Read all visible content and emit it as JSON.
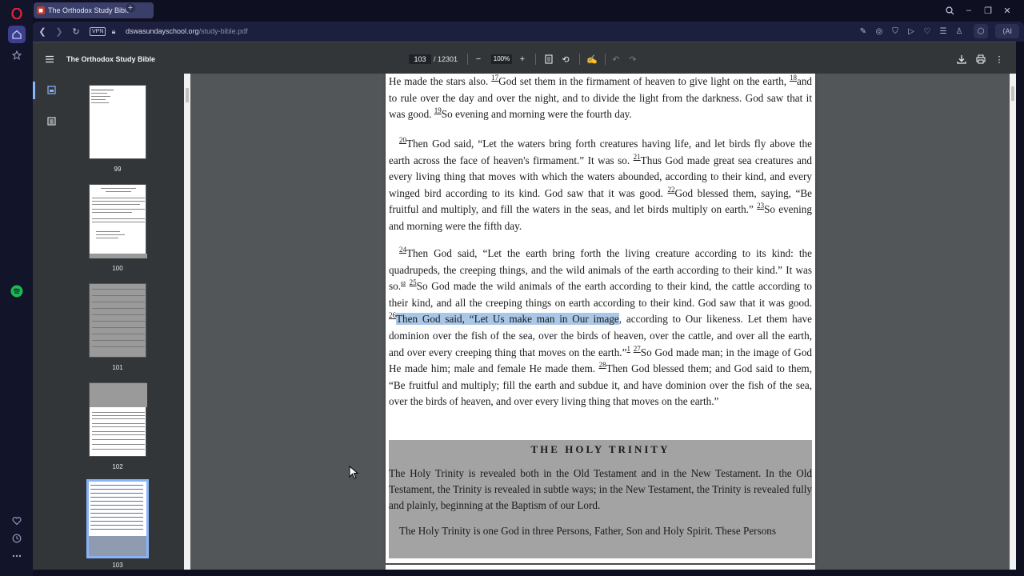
{
  "browser": {
    "tab_title": "The Orthodox Study Bible",
    "vpn_label": "VPN",
    "url_host": "dswasundayschool.org",
    "url_path": "/study-bible.pdf",
    "ai_label": "AI"
  },
  "toolbar": {
    "title": "The Orthodox Study Bible",
    "current_page": "103",
    "total_pages": "/ 12301",
    "zoom": "100%"
  },
  "thumbnails": [
    {
      "num": "99"
    },
    {
      "num": "100"
    },
    {
      "num": "101"
    },
    {
      "num": "102"
    },
    {
      "num": "103"
    }
  ],
  "document": {
    "p1_line1": "He made the stars also.",
    "v17": "17",
    "p1_text1": "God set them in the firmament of heaven to give light on the earth,",
    "v18": "18",
    "p1_text2": "and to rule over the day and over the night, and to divide the light from the darkness. God saw that it was good.",
    "v19": "19",
    "p1_text3": "So evening and morning were the fourth day.",
    "v20": "20",
    "p2_text1": "Then God said, “Let the waters bring forth creatures having life, and let birds fly above the earth across the face of heaven's firmament.” It was so.",
    "v21": "21",
    "p2_text2": "Thus God made great sea creatures and every living thing that moves with which the waters abounded, according to their kind, and every winged bird according to its kind. God saw that it was good.",
    "v22": "22",
    "p2_text3": "God blessed them, saying, “Be fruitful and multiply, and fill the waters in the seas, and let birds multiply on earth.”",
    "v23": "23",
    "p2_text4": "So evening and morning were the fifth day.",
    "v24": "24",
    "p3_text1": "Then God said, “Let the earth bring forth the living creature according to its kind: the quadrupeds, the creeping things, and the wild animals of the earth according to their kind.” It was so.",
    "fn_omega": "ω",
    "v25": "25",
    "p3_text2": "So God made the wild animals of the earth according to their kind, the cattle according to their kind, and all the creeping things on earth according to their kind. God saw that it was good.",
    "v26": "26",
    "p3_highlight": "Then God said, “Let Us make man in Our image",
    "p3_text3": ", according to Our likeness. Let them have dominion over the fish of the sea, over the birds of heaven, over the cattle, and over all the earth, and over every creeping thing that moves on the earth.”",
    "fn_1": "1",
    "v27": "27",
    "p3_text4": "So God made man; in the image of God He made him; male and female He made them.",
    "v28": "28",
    "p3_text5": "Then God blessed them; and God said to them, “Be fruitful and multiply; fill the earth and subdue it, and have dominion over the fish of the sea, over the birds of heaven, and over every living thing that moves on the earth.”",
    "trinity_title": "THE HOLY TRINITY",
    "trinity_p1": "The Holy Trinity is revealed both in the Old Testament and in the New Testament. In the Old Testament, the Trinity is revealed in subtle ways; in the New Testament, the Trinity is revealed fully and plainly, beginning at the Baptism of our Lord.",
    "trinity_p2": "The Holy Trinity is one God in three Persons, Father, Son and Holy Spirit. These Persons"
  },
  "colors": {
    "highlight": "#a9c7e6",
    "sidebar_bg": "#12142a",
    "toolbar_bg": "#323639",
    "viewport_bg": "#525659",
    "selected_thumb_border": "#8ab4f8"
  },
  "icons": [
    "opera-logo-icon",
    "home-icon",
    "star-icon",
    "spotify-icon",
    "heart-icon",
    "history-icon",
    "more-icon",
    "back-icon",
    "forward-icon",
    "reload-icon",
    "lock-icon",
    "menu-icon",
    "fit-page-icon",
    "rotate-icon",
    "draw-icon",
    "undo-icon",
    "redo-icon",
    "download-icon",
    "print-icon",
    "kebab-icon",
    "thumbnail-view-icon",
    "outline-view-icon"
  ]
}
